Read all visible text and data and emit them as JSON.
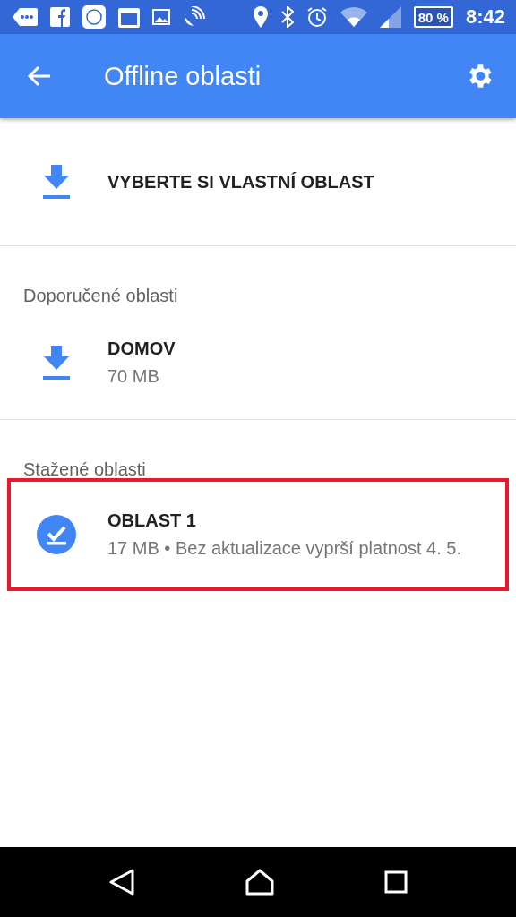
{
  "status_bar": {
    "battery": "80 %",
    "time": "8:42"
  },
  "app_bar": {
    "title": "Offline oblasti"
  },
  "sections": [
    {
      "items": [
        {
          "kind": "download",
          "title": "VYBERTE SI VLASTNÍ OBLAST",
          "highlighted": false
        }
      ]
    },
    {
      "header": "Doporučené oblasti",
      "items": [
        {
          "kind": "download",
          "title": "DOMOV",
          "subtitle": "70 MB",
          "highlighted": false
        }
      ]
    },
    {
      "header": "Stažené oblasti",
      "items": [
        {
          "kind": "downloaded",
          "title": "OBLAST 1",
          "subtitle": "17 MB • Bez aktualizace vyprší platnost 4. 5.",
          "highlighted": true
        }
      ]
    }
  ]
}
